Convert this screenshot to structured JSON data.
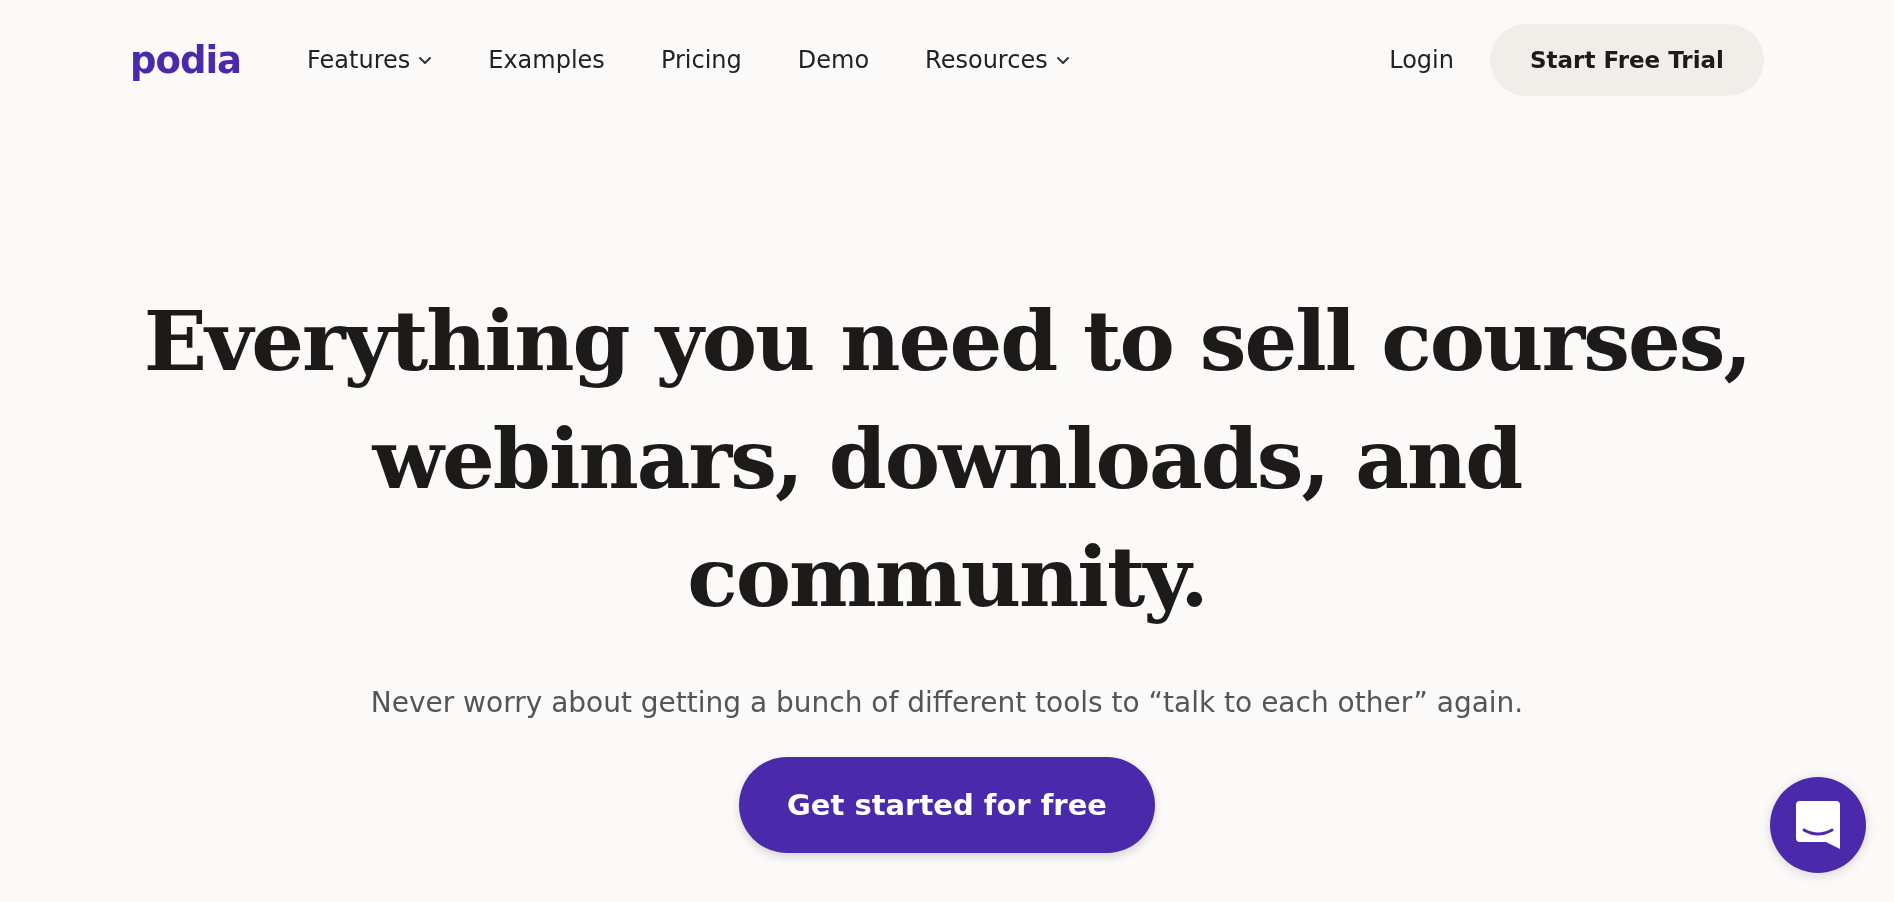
{
  "header": {
    "logo": "podia",
    "nav": [
      {
        "label": "Features",
        "dropdown": true
      },
      {
        "label": "Examples",
        "dropdown": false
      },
      {
        "label": "Pricing",
        "dropdown": false
      },
      {
        "label": "Demo",
        "dropdown": false
      },
      {
        "label": "Resources",
        "dropdown": true
      }
    ],
    "login": "Login",
    "cta": "Start Free Trial"
  },
  "hero": {
    "headline_lines": [
      "Everything you need to sell courses,",
      "webinars, downloads, and",
      "community."
    ],
    "subtitle": "Never worry about getting a bunch of different tools to “talk to each other” again.",
    "button": "Get started for free"
  },
  "chat_widget": {
    "kind": "launcher"
  }
}
